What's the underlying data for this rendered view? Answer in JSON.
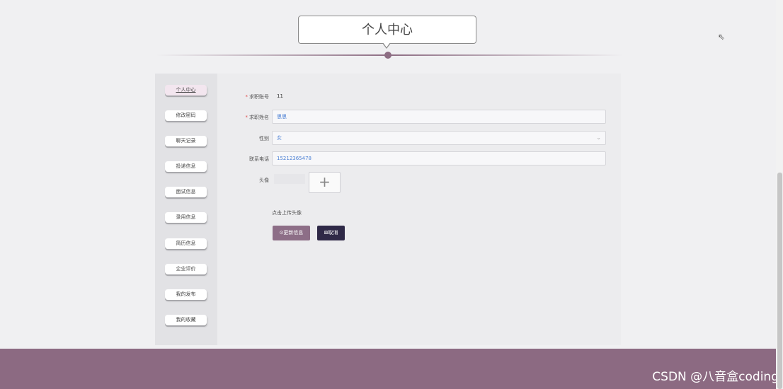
{
  "header": {
    "title": "个人中心"
  },
  "sidebar": {
    "items": [
      {
        "label": "个人中心"
      },
      {
        "label": "修改密码"
      },
      {
        "label": "聊天记录"
      },
      {
        "label": "投递信息"
      },
      {
        "label": "面试信息"
      },
      {
        "label": "录用信息"
      },
      {
        "label": "简历信息"
      },
      {
        "label": "企业评价"
      },
      {
        "label": "我的发布"
      },
      {
        "label": "我的收藏"
      }
    ]
  },
  "form": {
    "account": {
      "label": "求职账号",
      "value": "11"
    },
    "name": {
      "label": "求职姓名",
      "value": "思思"
    },
    "gender": {
      "label": "性别",
      "value": "女"
    },
    "phone": {
      "label": "联系电话",
      "value": "15212365478"
    },
    "avatar": {
      "label": "头像",
      "hint": "点击上传头像",
      "plus": "+"
    },
    "update_label": "⊙更新信息",
    "cancel_label": "⊠取消"
  },
  "footer": {
    "watermark": "CSDN @八音盒coding"
  },
  "colors": {
    "accent": "#8c6a82",
    "dark": "#2f2947"
  }
}
